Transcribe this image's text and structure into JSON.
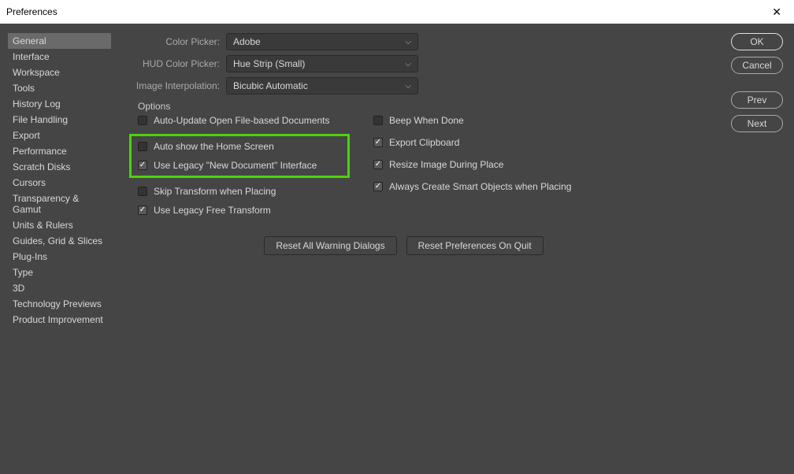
{
  "window": {
    "title": "Preferences"
  },
  "sidebar": {
    "items": [
      "General",
      "Interface",
      "Workspace",
      "Tools",
      "History Log",
      "File Handling",
      "Export",
      "Performance",
      "Scratch Disks",
      "Cursors",
      "Transparency & Gamut",
      "Units & Rulers",
      "Guides, Grid & Slices",
      "Plug-Ins",
      "Type",
      "3D",
      "Technology Previews",
      "Product Improvement"
    ],
    "active_index": 0
  },
  "form": {
    "color_picker_label": "Color Picker:",
    "color_picker_value": "Adobe",
    "hud_label": "HUD Color Picker:",
    "hud_value": "Hue Strip (Small)",
    "interp_label": "Image Interpolation:",
    "interp_value": "Bicubic Automatic"
  },
  "options": {
    "legend": "Options",
    "left": [
      {
        "label": "Auto-Update Open File-based Documents",
        "checked": false
      },
      {
        "label": "Auto show the Home Screen",
        "checked": false
      },
      {
        "label": "Use Legacy \"New Document\" Interface",
        "checked": true
      },
      {
        "label": "Skip Transform when Placing",
        "checked": false
      },
      {
        "label": "Use Legacy Free Transform",
        "checked": true
      }
    ],
    "right": [
      {
        "label": "Beep When Done",
        "checked": false
      },
      {
        "label": "Export Clipboard",
        "checked": true
      },
      {
        "label": "Resize Image During Place",
        "checked": true
      },
      {
        "label": "Always Create Smart Objects when Placing",
        "checked": true
      }
    ]
  },
  "buttons": {
    "reset_warnings": "Reset All Warning Dialogs",
    "reset_prefs": "Reset Preferences On Quit",
    "ok": "OK",
    "cancel": "Cancel",
    "prev": "Prev",
    "next": "Next"
  }
}
